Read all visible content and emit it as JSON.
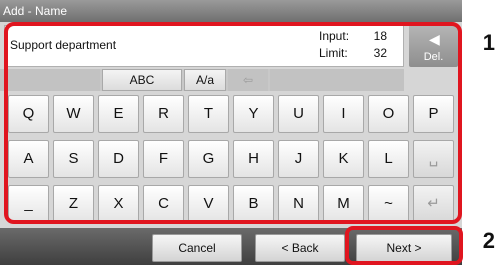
{
  "title": "Add - Name",
  "field": {
    "value": "Support department"
  },
  "meta": {
    "input_label": "Input:",
    "input_value": "18",
    "limit_label": "Limit:",
    "limit_value": "32"
  },
  "delete_label": "Del.",
  "options": {
    "abc": "ABC",
    "case": "A/a"
  },
  "keyboard": {
    "row1": [
      "Q",
      "W",
      "E",
      "R",
      "T",
      "Y",
      "U",
      "I",
      "O",
      "P"
    ],
    "row2": [
      "A",
      "S",
      "D",
      "F",
      "G",
      "H",
      "J",
      "K",
      "L",
      "␣"
    ],
    "row3": [
      "_",
      "Z",
      "X",
      "C",
      "V",
      "B",
      "N",
      "M",
      "~",
      "↵"
    ]
  },
  "bottom": {
    "cancel": "Cancel",
    "back": "< Back",
    "next": "Next >"
  },
  "callouts": {
    "one": "1",
    "two": "2"
  },
  "colors": {
    "highlight": "#e0151f"
  }
}
